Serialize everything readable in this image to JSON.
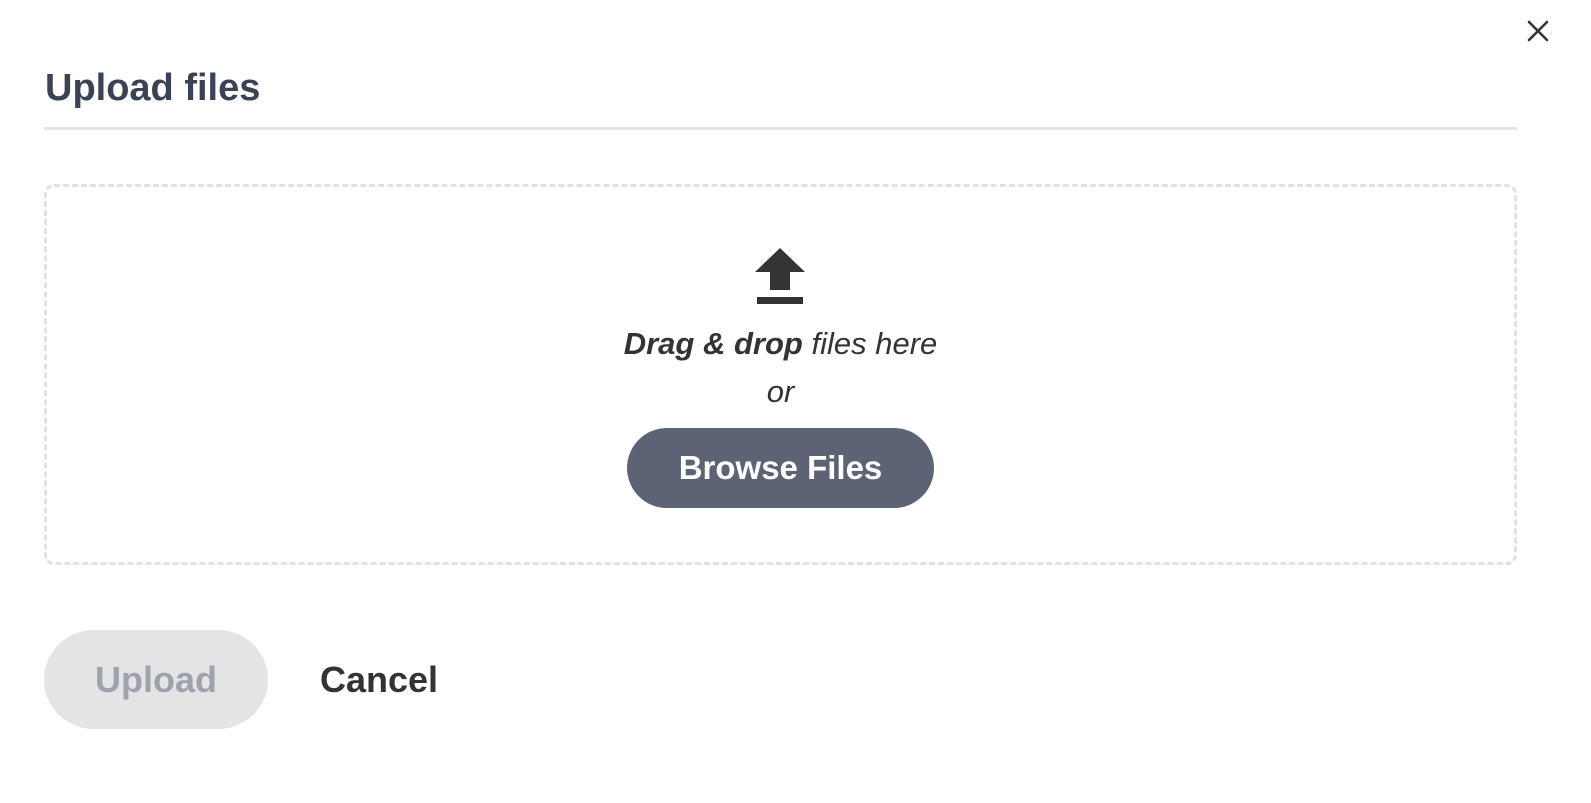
{
  "dialog": {
    "title": "Upload files",
    "close_icon": "close-icon"
  },
  "dropzone": {
    "icon": "upload-icon",
    "drag_bold": "Drag & drop",
    "drag_rest": " files here",
    "or_text": "or",
    "browse_label": "Browse Files"
  },
  "footer": {
    "upload_label": "Upload",
    "cancel_label": "Cancel"
  },
  "colors": {
    "title": "#3a4356",
    "browse_button_bg": "#5b6375",
    "upload_button_bg": "#e4e4e4",
    "upload_button_text": "#9ea2ad",
    "dropzone_border": "#e2e2e2"
  }
}
